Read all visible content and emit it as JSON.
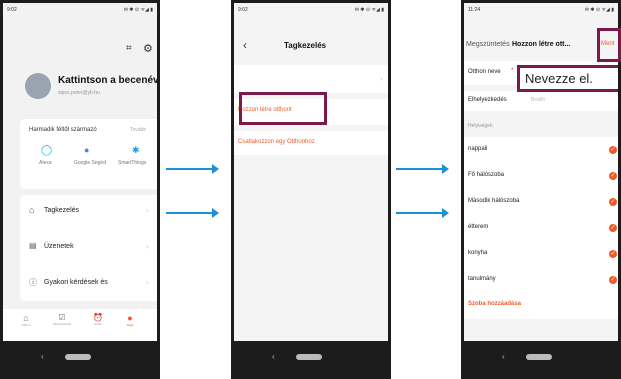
{
  "phone1": {
    "status_time": "9:02",
    "status_right": "✉ ✱ ⊙ ᯤ◢ ▮",
    "header_icons": [
      "scan-icon",
      "settings-icon"
    ],
    "profile_name": "Kattintson a becenév ...",
    "profile_email": "sipos.peter@yb.hu",
    "third_party_title": "Harmadik féltől származó",
    "third_party_more": "Tovább",
    "services": [
      "Alexa",
      "Google Segéd",
      "SmartThings"
    ],
    "menu": [
      "Tagkezelés",
      "Üzenetek",
      "Gyakori kérdések és"
    ],
    "tabs": [
      "Otthon",
      "Okosfunkciók",
      "Smart",
      "Saját"
    ]
  },
  "phone2": {
    "status_time": "9:02",
    "title": "Tagkezelés",
    "create_home": "Hozzon létre otthont",
    "join_home": "Csatlakozzon egy Otthonhoz"
  },
  "phone3": {
    "status_time": "11:24",
    "cancel": "Megszüntetés",
    "title": "Hozzon létre ott...",
    "save": "Ment",
    "name_label": "Otthon neve",
    "name_placeholder": "Nevezze el.",
    "location_label": "Elhelyezkedés",
    "location_value": "Beállít",
    "rooms_header": "Helyiségek:",
    "rooms": [
      "nappali",
      "Fő hálószoba",
      "Második hálószoba",
      "étterem",
      "konyha",
      "tanulmány"
    ],
    "add_room": "Szoba hozzáadása"
  },
  "colors": {
    "accent": "#ef5a2a",
    "arrow": "#1e90d8",
    "highlight": "#7a1a48"
  }
}
